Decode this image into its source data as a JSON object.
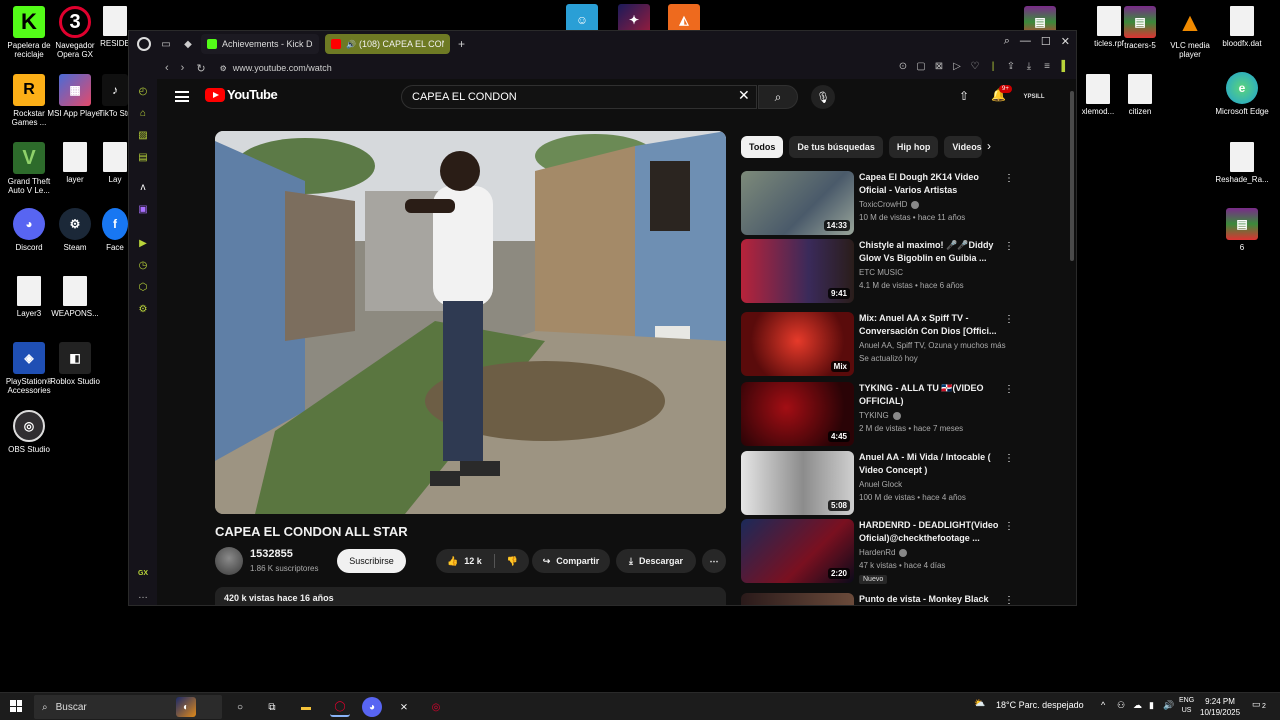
{
  "desktop": {
    "left_icons": [
      {
        "label": "Papelera de reciclaje",
        "icon": "kick-green-icon",
        "color": "#53fc18"
      },
      {
        "label": "Navegador Opera GX",
        "icon": "opera-gx-icon",
        "color": "#e0002e"
      },
      {
        "label": "RESIDE",
        "icon": "document-icon",
        "color": "#f2f2f2"
      },
      {
        "label": "Rockstar Games ...",
        "icon": "rockstar-icon",
        "color": "#fcaf17"
      },
      {
        "label": "MSI App Player",
        "icon": "msi-app-player-icon",
        "color": "#4a6bd6"
      },
      {
        "label": "TikTo Stu",
        "icon": "tiktok-icon",
        "color": "#101010"
      },
      {
        "label": "Grand Theft Auto V Le...",
        "icon": "gta-v-icon",
        "color": "#2d6b2b"
      },
      {
        "label": "layer",
        "icon": "document-icon",
        "color": "#f2f2f2"
      },
      {
        "label": "Lay",
        "icon": "document-icon",
        "color": "#f2f2f2"
      },
      {
        "label": "Discord",
        "icon": "discord-icon",
        "color": "#5865f2"
      },
      {
        "label": "Steam",
        "icon": "steam-icon",
        "color": "#1b2838"
      },
      {
        "label": "Face",
        "icon": "facebook-icon",
        "color": "#1877f2"
      },
      {
        "label": "Layer3",
        "icon": "document-icon",
        "color": "#f2f2f2"
      },
      {
        "label": "WEAPONS...",
        "icon": "document-icon",
        "color": "#f2f2f2"
      },
      {
        "label": "PlayStation® Accessories",
        "icon": "playstation-icon",
        "color": "#1f4fb4"
      },
      {
        "label": "Roblox Studio",
        "icon": "roblox-icon",
        "color": "#222222"
      },
      {
        "label": "OBS Studio",
        "icon": "obs-icon",
        "color": "#302e31"
      }
    ],
    "right_icons": [
      {
        "label": "ticles.rpf",
        "icon": "winrar-icon",
        "color": "#7a2a8a"
      },
      {
        "label": "",
        "icon": "document-icon",
        "color": "#f2f2f2"
      },
      {
        "label": "tracers-5",
        "icon": "winrar-icon",
        "color": "#7a2a8a"
      },
      {
        "label": "VLC media player",
        "icon": "vlc-icon",
        "color": "#f08a00"
      },
      {
        "label": "bloodfx.dat",
        "icon": "document-icon",
        "color": "#f2f2f2"
      },
      {
        "label": "xlemod...",
        "icon": "document-icon",
        "color": "#f2f2f2"
      },
      {
        "label": "citizen",
        "icon": "folder-icon",
        "color": "#f2f2f2"
      },
      {
        "label": "Microsoft Edge",
        "icon": "edge-icon",
        "color": "#1fa2d6"
      },
      {
        "label": "Reshade_Ra...",
        "icon": "document-icon",
        "color": "#f2f2f2"
      },
      {
        "label": "6",
        "icon": "winrar-icon",
        "color": "#7a2a8a"
      }
    ],
    "top_icons": [
      {
        "label": "",
        "icon": "game-icon-1",
        "color": "#2a9fd6"
      },
      {
        "label": "",
        "icon": "game-icon-2",
        "color": "#9b1c3c"
      },
      {
        "label": "",
        "icon": "game-icon-3",
        "color": "#ee6a1e"
      }
    ]
  },
  "browser": {
    "tabs": [
      {
        "title": "Achievements - Kick Dash",
        "favicon": "kick-icon",
        "active": false
      },
      {
        "title": "(108) CAPEA EL CONDON",
        "favicon": "youtube-icon",
        "active": true
      }
    ],
    "url": "www.youtube.com/watch",
    "accent": "#b9d43a"
  },
  "youtube": {
    "logo": "YouTube",
    "search_query": "CAPEA EL CONDON",
    "notification_count": "9+",
    "avatar_label": "YPSILL",
    "video": {
      "title": "CAPEA EL CONDON ALL STAR",
      "channel": "1532855",
      "subscribers": "1.86 K suscriptores",
      "subscribe_label": "Suscribirse",
      "likes": "12 k",
      "share_label": "Compartir",
      "download_label": "Descargar",
      "meta": "420 k vistas  hace 16 años"
    },
    "chips": [
      "Todos",
      "De tus búsquedas",
      "Hip hop",
      "Videos"
    ],
    "recommendations": [
      {
        "title": "Capea El Dough 2K14 Video Oficial - Varios Artistas",
        "channel": "ToxicCrowHD",
        "verified": true,
        "meta": "10 M de vistas • hace 11 años",
        "duration": "14:33",
        "badge": ""
      },
      {
        "title": "Chistyle al maximo! 🎤🎤Diddy Glow Vs Bigoblin en Guibia ...",
        "channel": "ETC MUSIC",
        "verified": false,
        "meta": "4.1 M de vistas • hace 6 años",
        "duration": "9:41",
        "badge": ""
      },
      {
        "title": "Mix: Anuel AA x Spiff TV - Conversación Con Dios [Offici...",
        "channel": "Anuel AA, Spiff TV, Ozuna y muchos más",
        "verified": false,
        "meta": "Se actualizó hoy",
        "duration": "Mix",
        "badge": ""
      },
      {
        "title": "TYKING - ALLA TU 🇩🇴(VIDEO OFFICIAL)",
        "channel": "TYKING",
        "verified": true,
        "meta": "2 M de vistas • hace 7 meses",
        "duration": "4:45",
        "badge": ""
      },
      {
        "title": "Anuel AA - Mi Vida / Intocable ( Video Concept )",
        "channel": "Anuel Glock",
        "verified": false,
        "meta": "100 M de vistas • hace 4 años",
        "duration": "5:08",
        "badge": ""
      },
      {
        "title": "HARDENRD - DEADLIGHT(Video Oficial)@checkthefootage ...",
        "channel": "HardenRd",
        "verified": true,
        "meta": "47 k vistas • hace 4 días",
        "duration": "2:20",
        "badge": "Nuevo"
      },
      {
        "title": "Punto de vista - Monkey Black",
        "channel": "",
        "verified": false,
        "meta": "",
        "duration": "",
        "badge": ""
      }
    ]
  },
  "taskbar": {
    "search_placeholder": "Buscar",
    "weather": "18°C  Parc. despejado",
    "lang_top": "ENG",
    "lang_bottom": "US",
    "time": "9:24 PM",
    "date": "10/19/2025",
    "notifications": "2"
  }
}
